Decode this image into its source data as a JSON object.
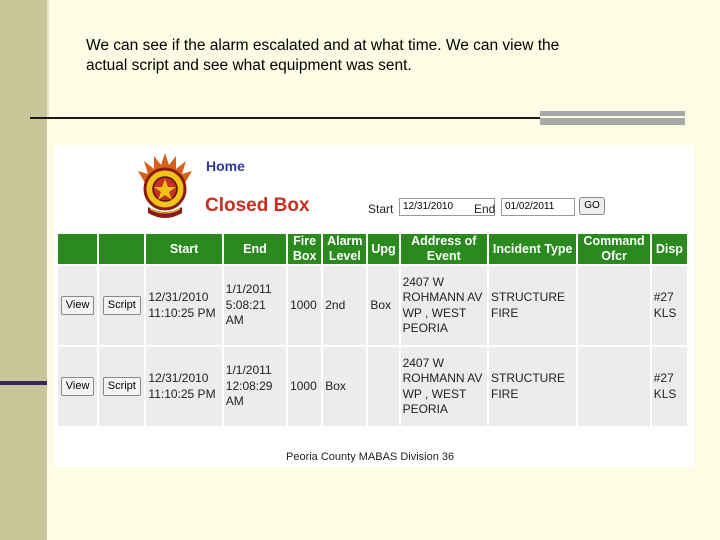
{
  "slide": {
    "caption": "We can see if the alarm escalated and at what time.  We can view the\nactual script and see what equipment was sent."
  },
  "header": {
    "home_link": "Home",
    "page_title": "Closed Box",
    "start_label": "Start",
    "start_value": "12/31/2010",
    "end_label": "End",
    "end_value": "01/02/2011",
    "go_label": "GO"
  },
  "table": {
    "headers": [
      "",
      "",
      "Start",
      "End",
      "Fire Box",
      "Alarm Level",
      "Upg",
      "Address of Event",
      "Incident Type",
      "Command Ofcr",
      "Disp"
    ],
    "rows": [
      {
        "view": "View",
        "script": "Script",
        "start": "12/31/2010 11:10:25 PM",
        "end": "1/1/2011 5:08:21 AM",
        "fire_box": "1000",
        "alarm_level": "2nd",
        "upg": "Box",
        "address": "2407 W ROHMANN AV WP , WEST PEORIA",
        "incident_type": "STRUCTURE FIRE",
        "command_ofcr": "",
        "disp": "#27 KLS"
      },
      {
        "view": "View",
        "script": "Script",
        "start": "12/31/2010 11:10:25 PM",
        "end": "1/1/2011 12:08:29 AM",
        "fire_box": "1000",
        "alarm_level": "Box",
        "upg": "",
        "address": "2407 W ROHMANN AV WP , WEST PEORIA",
        "incident_type": "STRUCTURE FIRE",
        "command_ofcr": "",
        "disp": "#27 KLS"
      }
    ]
  },
  "footer": {
    "text": "Peoria County MABAS Division 36"
  },
  "colors": {
    "header_green": "#2a8a1e",
    "title_red": "#c62f22",
    "link_blue": "#2b3a9c",
    "slide_bg": "#fdfde6",
    "side_bar": "#c9c79a"
  },
  "icons": {
    "emblem": "fire-department-emblem-icon"
  }
}
